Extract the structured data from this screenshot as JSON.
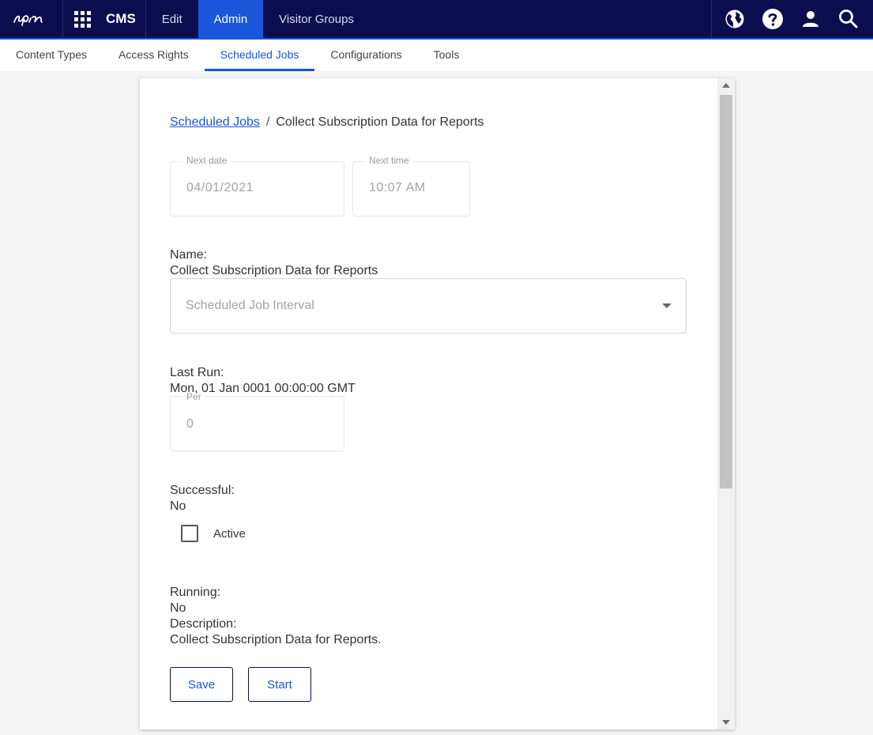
{
  "topbar": {
    "product": "CMS",
    "tabs": [
      {
        "label": "Edit",
        "active": false
      },
      {
        "label": "Admin",
        "active": true
      },
      {
        "label": "Visitor Groups",
        "active": false
      }
    ],
    "icons": [
      "globe-icon",
      "help-icon",
      "user-icon",
      "search-icon"
    ]
  },
  "subnav": {
    "tabs": [
      {
        "label": "Content Types",
        "active": false
      },
      {
        "label": "Access Rights",
        "active": false
      },
      {
        "label": "Scheduled Jobs",
        "active": true
      },
      {
        "label": "Configurations",
        "active": false
      },
      {
        "label": "Tools",
        "active": false
      }
    ]
  },
  "breadcrumb": {
    "parent": "Scheduled Jobs",
    "separator": "/",
    "current": "Collect Subscription Data for Reports"
  },
  "next_date": {
    "label": "Next date",
    "value": "04/01/2021"
  },
  "next_time": {
    "label": "Next time",
    "value": "10:07 AM"
  },
  "name": {
    "label": "Name:",
    "value": "Collect Subscription Data for Reports"
  },
  "interval": {
    "placeholder": "Scheduled Job Interval"
  },
  "last_run": {
    "label": "Last Run:",
    "value": "Mon, 01 Jan 0001 00:00:00 GMT"
  },
  "per": {
    "label": "Per",
    "value": "0"
  },
  "successful": {
    "label": "Successful:",
    "value": "No"
  },
  "active": {
    "label": "Active",
    "checked": false
  },
  "running": {
    "label": "Running:",
    "value": "No"
  },
  "description": {
    "label": "Description:",
    "value": "Collect Subscription Data for Reports."
  },
  "buttons": {
    "save": "Save",
    "start": "Start"
  },
  "colors": {
    "topbar": "#0a0e4f",
    "accent": "#1a56d9"
  }
}
